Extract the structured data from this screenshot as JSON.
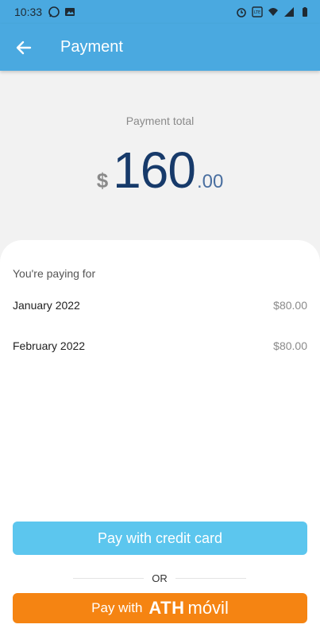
{
  "status_bar": {
    "time": "10:33",
    "left_icons": [
      "whatsapp-icon",
      "image-icon"
    ],
    "right_icons": [
      "alarm-icon",
      "volte-icon",
      "wifi-icon",
      "signal-icon",
      "battery-icon"
    ]
  },
  "app_bar": {
    "title": "Payment",
    "back_icon": "arrow-left-icon"
  },
  "total": {
    "label": "Payment total",
    "currency": "$",
    "main": "160",
    "cents": ".00"
  },
  "paying_for": {
    "label": "You're paying for",
    "items": [
      {
        "label": "January 2022",
        "amount": "$80.00"
      },
      {
        "label": "February 2022",
        "amount": "$80.00"
      }
    ]
  },
  "actions": {
    "credit_card_label": "Pay with credit card",
    "or_label": "OR",
    "ath_prefix": "Pay with",
    "ath_brand": "ATH",
    "ath_brand_suffix": "móvil"
  },
  "colors": {
    "primary": "#4aa9e0",
    "credit_button": "#5cc6ee",
    "ath_button": "#f58412",
    "amount_main": "#173a6a"
  }
}
